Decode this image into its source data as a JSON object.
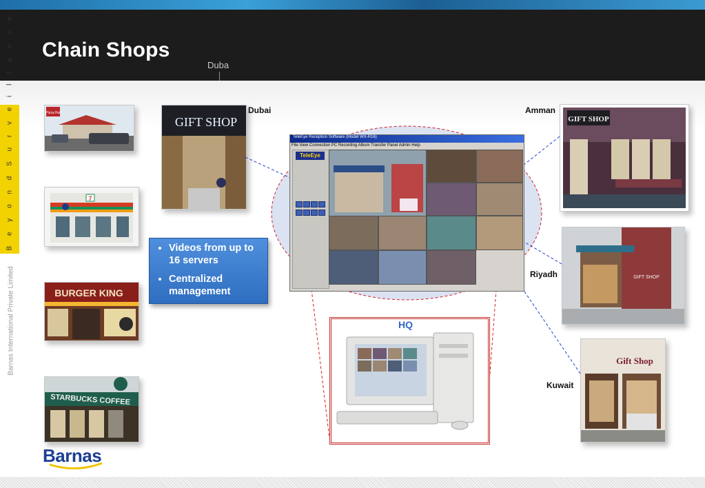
{
  "slide": {
    "title": "Chain Shops",
    "stray_label": "Duba"
  },
  "sidebar": {
    "tagline": "B e y o n d   S u r v e i l l a n c e",
    "company": "Barnas International Private Limited",
    "tag_color": "#f2d200"
  },
  "bullets": [
    "Videos from up to 16 servers",
    "Centralized management"
  ],
  "locations": {
    "dubai": "Dubai",
    "amman": "Amman",
    "riyadh": "Riyadh",
    "kuwait": "Kuwait",
    "hq": "HQ"
  },
  "shop_signs": {
    "pizza_hut": "Pizza Hut",
    "seven_eleven": "7",
    "burger_king": "BURGER KING",
    "starbucks": "STARBUCKS COFFEE",
    "gift_shop_dubai": "GIFT SHOP",
    "gift_shop_amman": "GIFT SHOP",
    "gift_shop_riyadh": "GIFT SHOP",
    "gift_shop_kuwait": "Gift Shop"
  },
  "software": {
    "window_title": "TeleEye Reception Software (Model WX-R16)",
    "menu": "File  View  Connection  PC Recording  Album  Transfer  Panel  Admin  Help",
    "logo": "TeleEye"
  },
  "logo": {
    "name": "Barnas"
  },
  "colors": {
    "title_band": "#1c1c1c",
    "bullet_box": "#2f6ec0",
    "connector_blue": "#1f3fd0",
    "connector_red": "#d42020",
    "hq_text": "#3166c8"
  }
}
